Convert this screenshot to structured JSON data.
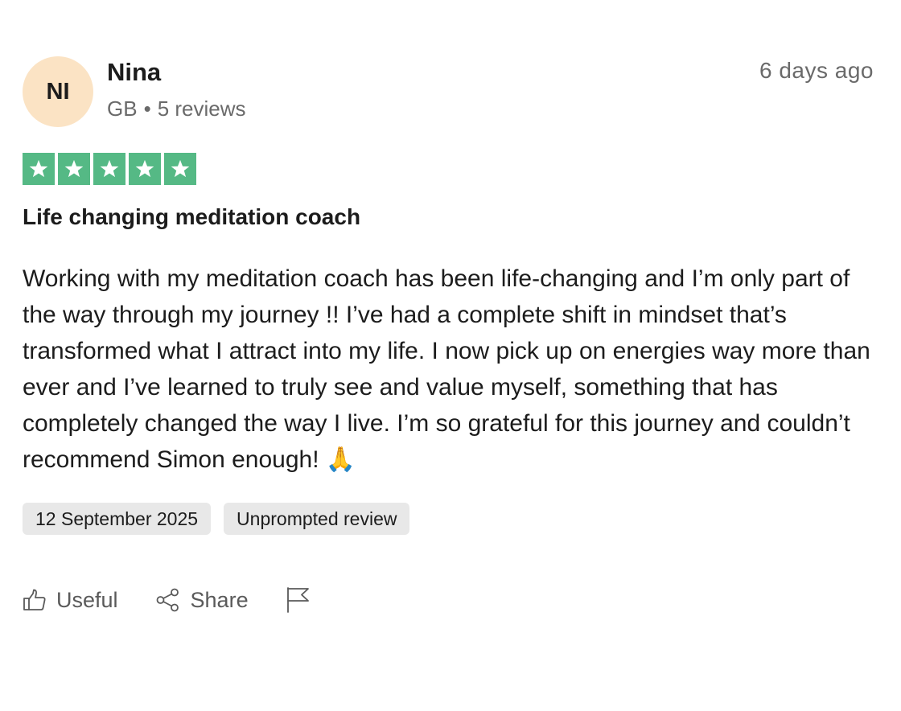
{
  "reviewer": {
    "initials": "NI",
    "name": "Nina",
    "country": "GB",
    "separator": "•",
    "review_count": "5 reviews"
  },
  "review": {
    "age": "6 days ago",
    "rating": 5,
    "rating_max": 5,
    "star_color": "#55b985",
    "title": "Life changing meditation coach",
    "body": "Working with my meditation coach has been life-changing and I’m only part of the way through my journey !! I’ve had a complete shift in mindset that’s transformed what I attract into my life. I now pick up on energies way more than ever and I’ve learned to truly see and value myself, something that has completely changed the way I live. I’m so grateful for this journey and couldn’t recommend Simon enough! 🙏",
    "date": "12 September 2025",
    "tag": "Unprompted review"
  },
  "actions": {
    "useful_label": "Useful",
    "share_label": "Share",
    "useful_icon": "thumbs-up-icon",
    "share_icon": "share-icon",
    "report_icon": "flag-icon"
  },
  "colors": {
    "avatar_bg": "#fbe3c4",
    "pill_bg": "#e8e8e8",
    "muted_text": "#6a6a6a"
  }
}
